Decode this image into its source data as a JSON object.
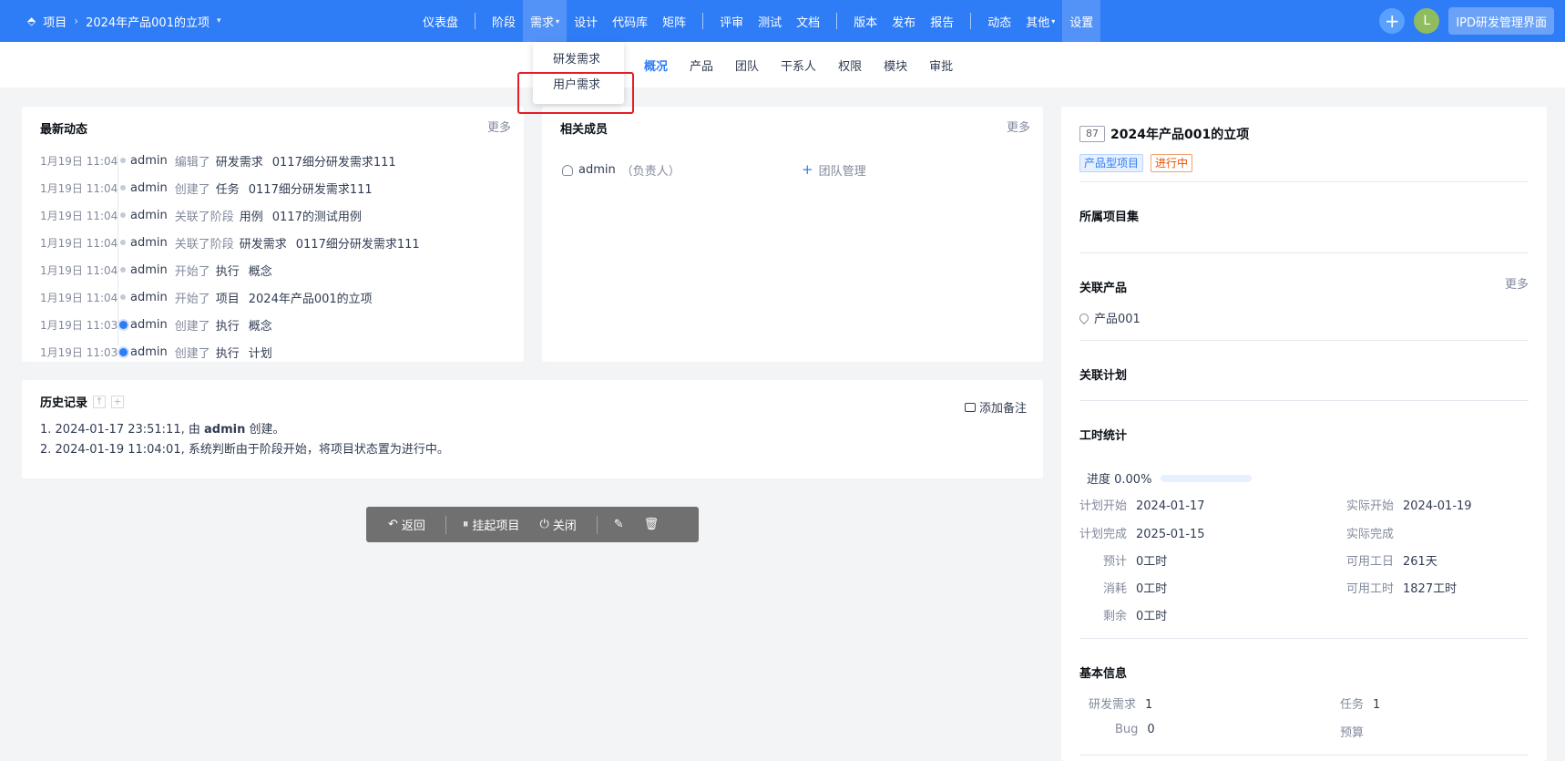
{
  "topbar": {
    "breadcrumb": {
      "root": "项目",
      "project": "2024年产品001的立项"
    },
    "nav": [
      {
        "label": "仪表盘"
      },
      {
        "label": "阶段"
      },
      {
        "label": "需求"
      },
      {
        "label": "设计"
      },
      {
        "label": "代码库"
      },
      {
        "label": "矩阵"
      },
      {
        "label": "评审"
      },
      {
        "label": "测试"
      },
      {
        "label": "文档"
      },
      {
        "label": "版本"
      },
      {
        "label": "发布"
      },
      {
        "label": "报告"
      },
      {
        "label": "动态"
      },
      {
        "label": "其他"
      },
      {
        "label": "设置"
      }
    ],
    "avatar_letter": "L",
    "ipd_button": "IPD研发管理界面"
  },
  "dropdown": {
    "items": [
      "研发需求",
      "用户需求"
    ]
  },
  "subnav": {
    "items": [
      "概况",
      "产品",
      "团队",
      "干系人",
      "权限",
      "模块",
      "审批"
    ]
  },
  "dynamics": {
    "title": "最新动态",
    "more": "更多",
    "rows": [
      {
        "time": "1月19日 11:04",
        "user": "admin",
        "action": "编辑了",
        "type": "研发需求",
        "object": "0117细分研发需求111"
      },
      {
        "time": "1月19日 11:04",
        "user": "admin",
        "action": "创建了",
        "type": "任务",
        "object": "0117细分研发需求111"
      },
      {
        "time": "1月19日 11:04",
        "user": "admin",
        "action": "关联了阶段",
        "type": "用例",
        "object": "0117的测试用例"
      },
      {
        "time": "1月19日 11:04",
        "user": "admin",
        "action": "关联了阶段",
        "type": "研发需求",
        "object": "0117细分研发需求111"
      },
      {
        "time": "1月19日 11:04",
        "user": "admin",
        "action": "开始了",
        "type": "执行",
        "object": "概念"
      },
      {
        "time": "1月19日 11:04",
        "user": "admin",
        "action": "开始了",
        "type": "项目",
        "object": "2024年产品001的立项"
      },
      {
        "time": "1月19日 11:03",
        "user": "admin",
        "action": "创建了",
        "type": "执行",
        "object": "概念"
      },
      {
        "time": "1月19日 11:03",
        "user": "admin",
        "action": "创建了",
        "type": "执行",
        "object": "计划"
      }
    ]
  },
  "members": {
    "title": "相关成员",
    "more": "更多",
    "name": "admin",
    "role": "（负责人）",
    "team_mgmt": "团队管理"
  },
  "history": {
    "title": "历史记录",
    "add_note": "添加备注",
    "line1_prefix": "1. 2024-01-17 23:51:11, 由 ",
    "line1_user": "admin",
    "line1_suffix": " 创建。",
    "line2": "2. 2024-01-19 11:04:01, 系统判断由于阶段开始，将项目状态置为进行中。"
  },
  "actions": {
    "back": "返回",
    "suspend": "挂起项目",
    "close": "关闭"
  },
  "detail": {
    "id": "87",
    "name": "2024年产品001的立项",
    "tag_type": "产品型项目",
    "tag_status": "进行中",
    "sec_program": "所属项目集",
    "sec_products": "关联产品",
    "products_more": "更多",
    "product": "产品001",
    "sec_plans": "关联计划",
    "sec_hours": "工时统计",
    "progress_label": "进度 0.00%",
    "progress_value": 0.0,
    "plan_start_k": "计划开始",
    "plan_start_v": "2024-01-17",
    "real_start_k": "实际开始",
    "real_start_v": "2024-01-19",
    "plan_end_k": "计划完成",
    "plan_end_v": "2025-01-15",
    "real_end_k": "实际完成",
    "real_end_v": "",
    "estimate_k": "预计",
    "estimate_v": "0工时",
    "workdays_k": "可用工日",
    "workdays_v": "261天",
    "consumed_k": "消耗",
    "consumed_v": "0工时",
    "workhours_k": "可用工时",
    "workhours_v": "1827工时",
    "left_k": "剩余",
    "left_v": "0工时",
    "sec_basic": "基本信息",
    "story_k": "研发需求",
    "story_v": "1",
    "task_k": "任务",
    "task_v": "1",
    "bug_k": "Bug",
    "bug_v": "0",
    "budget_k": "预算",
    "budget_v": ""
  },
  "colors": {
    "primary": "#2e7cf6",
    "highlight": "#e51c23",
    "status": "#e65100"
  }
}
